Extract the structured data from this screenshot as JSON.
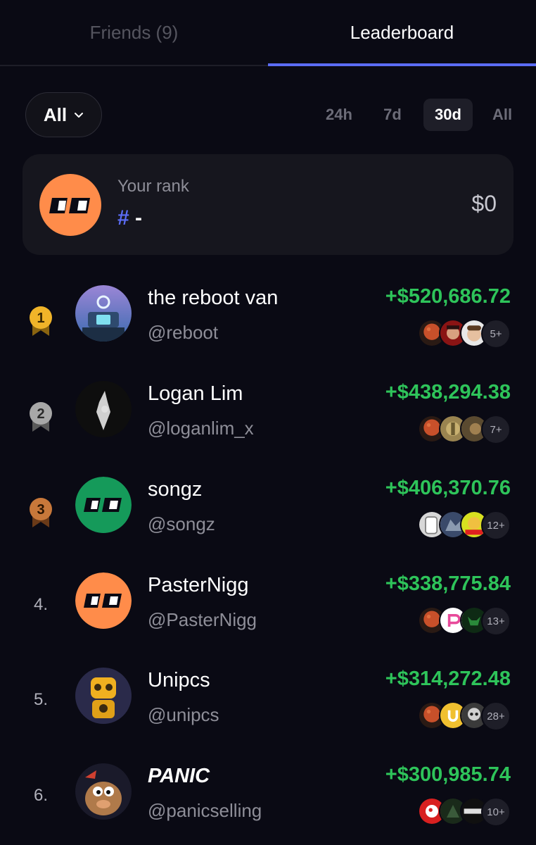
{
  "tabs": {
    "friends": "Friends (9)",
    "leaderboard": "Leaderboard"
  },
  "filter": {
    "selected": "All"
  },
  "periods": [
    "24h",
    "7d",
    "30d",
    "All"
  ],
  "selected_period": "30d",
  "your_rank": {
    "label": "Your rank",
    "hash": "#",
    "value": "-",
    "amount": "$0"
  },
  "accent_color": "#5b6cf5",
  "gain_color": "#2ec45a",
  "leaderboard": [
    {
      "rank": "1",
      "name": "the reboot van",
      "handle": "@reboot",
      "pnl": "+$520,686.72",
      "more": "5+",
      "tokens": [
        "mars-token-icon",
        "red-face-token-icon",
        "man-token-icon"
      ]
    },
    {
      "rank": "2",
      "name": "Logan Lim",
      "handle": "@loganlim_x",
      "pnl": "+$438,294.38",
      "more": "7+",
      "tokens": [
        "mars-token-icon",
        "gold-token-icon",
        "brown-token-icon"
      ]
    },
    {
      "rank": "3",
      "name": "songz",
      "handle": "@songz",
      "pnl": "+$406,370.76",
      "more": "12+",
      "tokens": [
        "f-token-icon",
        "wolf-token-icon",
        "yolo-token-icon"
      ]
    },
    {
      "rank": "4.",
      "name": "PasterNigg",
      "handle": "@PasterNigg",
      "pnl": "+$338,775.84",
      "more": "13+",
      "tokens": [
        "mars-token-icon",
        "pink-p-token-icon",
        "bull-token-icon"
      ]
    },
    {
      "rank": "5.",
      "name": "Unipcs",
      "handle": "@unipcs",
      "pnl": "+$314,272.48",
      "more": "28+",
      "tokens": [
        "mars-token-icon",
        "gold-u-token-icon",
        "skull-token-icon"
      ]
    },
    {
      "rank": "6.",
      "name": "PANIC",
      "handle": "@panicselling",
      "pnl": "+$300,985.74",
      "more": "10+",
      "tokens": [
        "red-white-token-icon",
        "green-dark-token-icon",
        "knights-token-icon"
      ]
    }
  ],
  "token_labels": {
    "mars": "MarsCoin",
    "yolo": "YOLO",
    "knights": "knights"
  }
}
